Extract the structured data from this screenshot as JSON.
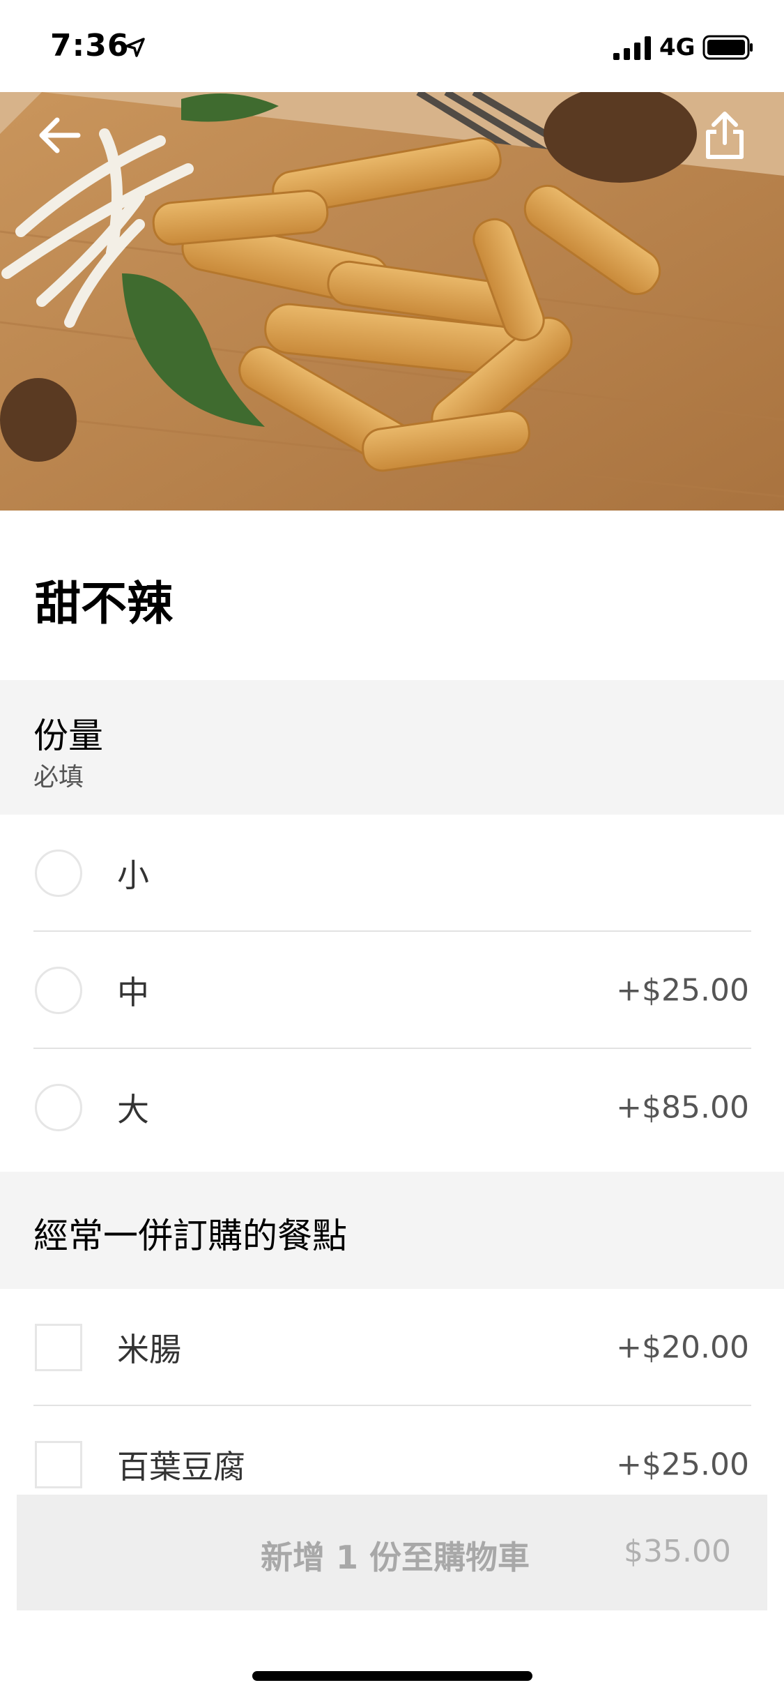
{
  "status_bar": {
    "time": "7:36",
    "network": "4G",
    "icons": [
      "location-arrow-icon",
      "signal-bars-icon",
      "battery-icon"
    ]
  },
  "hero": {
    "back_icon": "arrow-left-icon",
    "share_icon": "share-icon"
  },
  "item": {
    "title": "甜不辣"
  },
  "portion_section": {
    "title": "份量",
    "subtitle": "必填",
    "options": [
      {
        "label": "小",
        "price": ""
      },
      {
        "label": "中",
        "price": "+$25.00"
      },
      {
        "label": "大",
        "price": "+$85.00"
      }
    ]
  },
  "combo_section": {
    "title": "經常一併訂購的餐點",
    "options": [
      {
        "label": "米腸",
        "price": "+$20.00"
      },
      {
        "label": "百葉豆腐",
        "price": "+$25.00"
      }
    ]
  },
  "cart": {
    "label": "新增 1 份至購物車",
    "price": "$35.00"
  },
  "colors": {
    "section_bg": "#f4f4f4",
    "cart_bg": "#eeeeee",
    "cart_text": "#a8a8a8"
  }
}
